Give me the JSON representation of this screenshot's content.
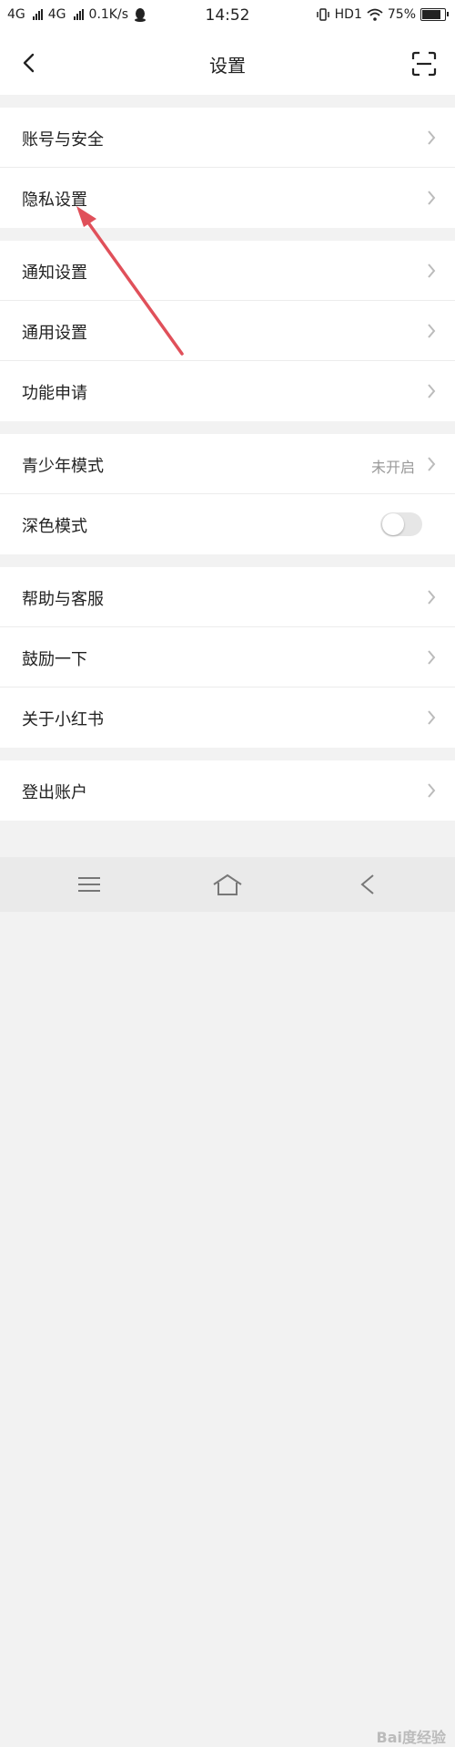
{
  "status_bar": {
    "net1": "4G",
    "net2": "4G",
    "speed": "0.1K/s",
    "time": "14:52",
    "hd": "HD1",
    "battery": "75%"
  },
  "header": {
    "title": "设置"
  },
  "groups": [
    {
      "items": [
        {
          "label": "账号与安全"
        },
        {
          "label": "隐私设置"
        }
      ]
    },
    {
      "items": [
        {
          "label": "通知设置"
        },
        {
          "label": "通用设置"
        },
        {
          "label": "功能申请"
        }
      ]
    },
    {
      "items": [
        {
          "label": "青少年模式",
          "value": "未开启"
        },
        {
          "label": "深色模式",
          "toggle": false
        }
      ]
    },
    {
      "items": [
        {
          "label": "帮助与客服"
        },
        {
          "label": "鼓励一下"
        },
        {
          "label": "关于小红书"
        }
      ]
    },
    {
      "items": [
        {
          "label": "登出账户"
        }
      ]
    }
  ],
  "icons": {
    "back": "back-arrow-icon",
    "scan": "scan-icon",
    "chevron": "chevron-right-icon",
    "nav_menu": "menu-icon",
    "nav_home": "home-icon",
    "nav_back": "back-icon"
  },
  "annotation": {
    "color": "#e0505a"
  },
  "watermark": "Bai度经验"
}
